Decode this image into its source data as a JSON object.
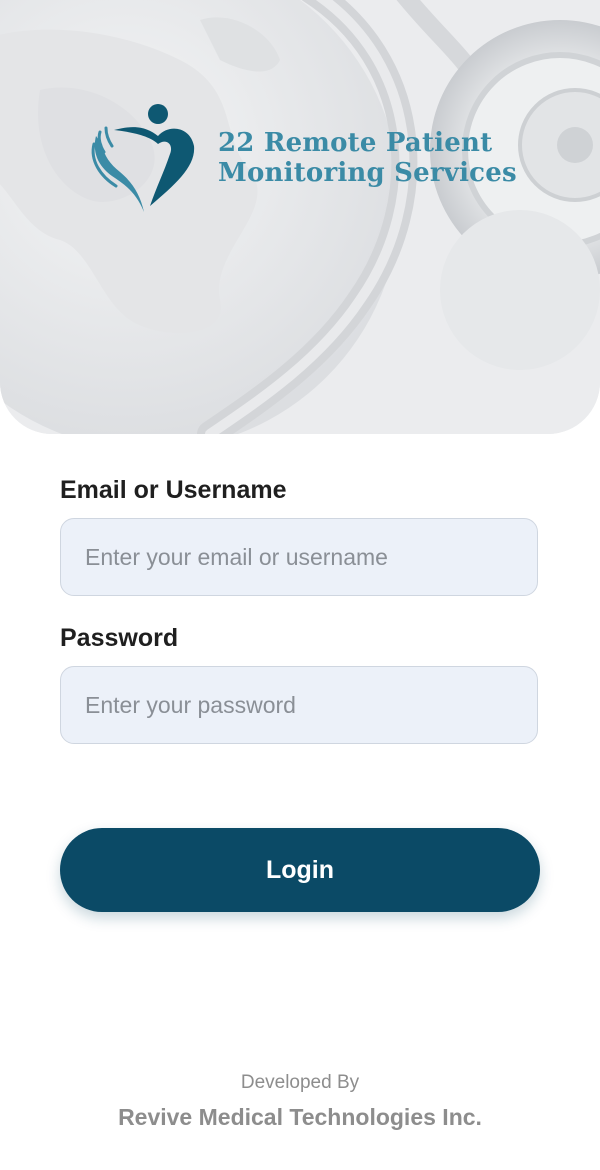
{
  "header": {
    "logo_line1": "22 Remote Patient",
    "logo_line2": "Monitoring Services"
  },
  "form": {
    "email_label": "Email or Username",
    "email_placeholder": "Enter your email or username",
    "email_value": "",
    "password_label": "Password",
    "password_placeholder": "Enter your password",
    "password_value": ""
  },
  "actions": {
    "login_label": "Login"
  },
  "footer": {
    "developed_by": "Developed By",
    "company": "Revive Medical Technologies Inc."
  },
  "colors": {
    "brand_primary": "#0b4a66",
    "brand_secondary": "#3b8ba6",
    "input_background": "#ecf1f9"
  }
}
